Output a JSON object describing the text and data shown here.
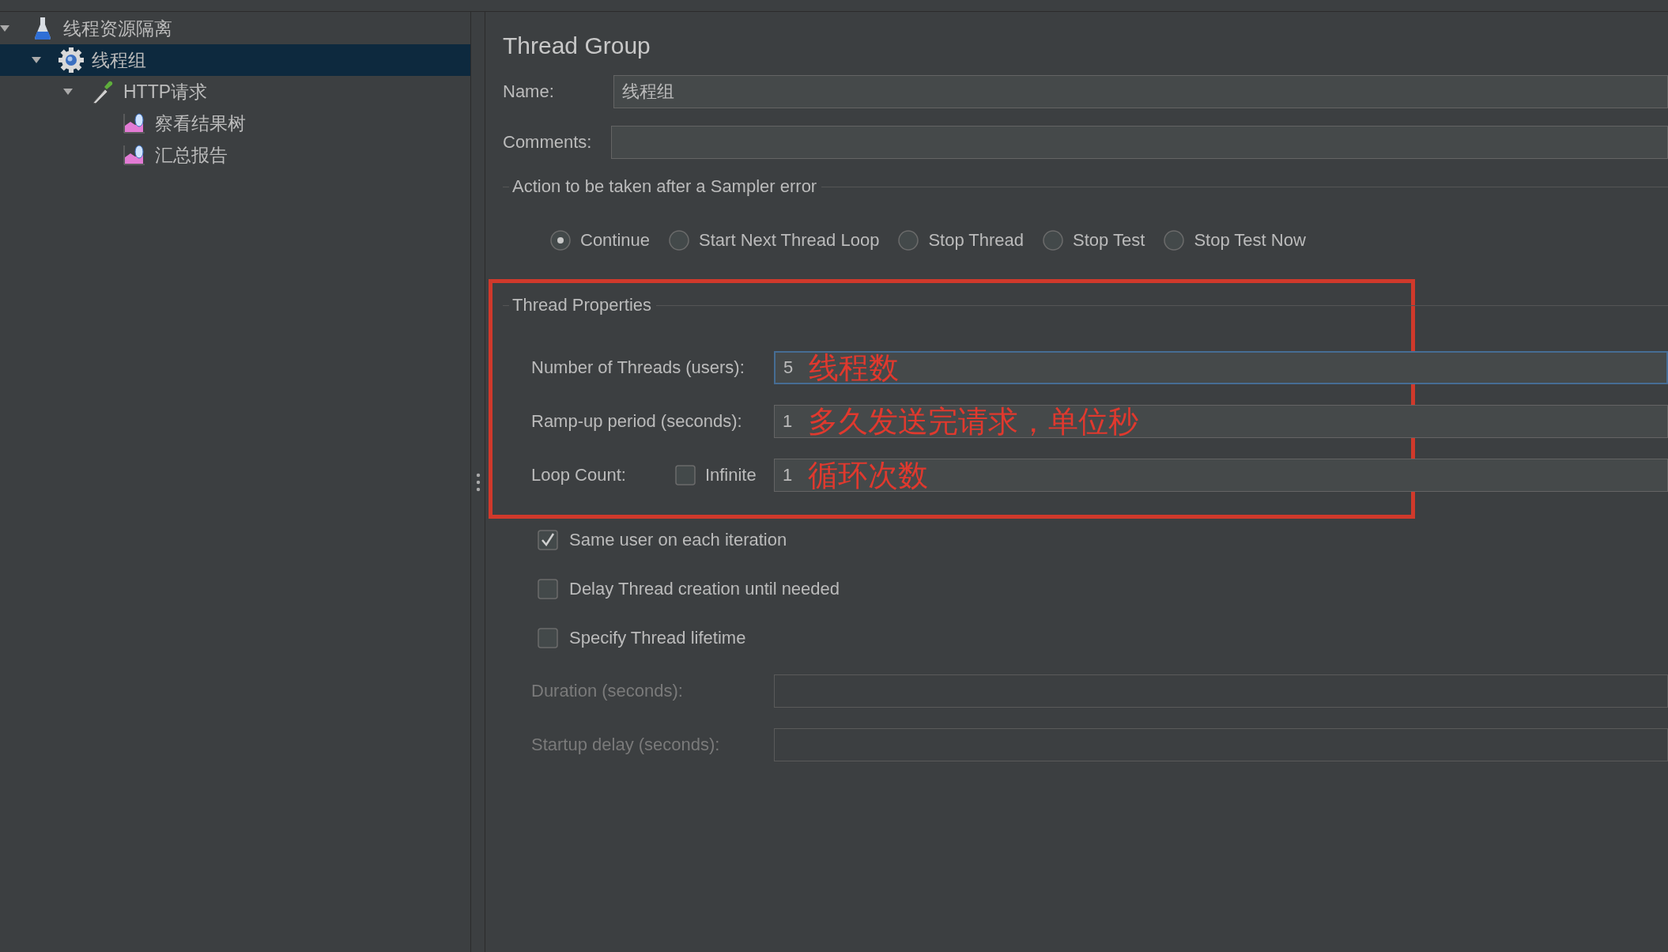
{
  "tree": [
    {
      "label": "线程资源隔离",
      "kind": "plan",
      "expanded": true,
      "selected": false,
      "children": [
        {
          "label": "线程组",
          "kind": "thread-group",
          "expanded": true,
          "selected": true,
          "children": [
            {
              "label": "HTTP请求",
              "kind": "sampler",
              "expanded": true,
              "selected": false,
              "children": [
                {
                  "label": "察看结果树",
                  "kind": "listener",
                  "selected": false
                },
                {
                  "label": "汇总报告",
                  "kind": "listener",
                  "selected": false
                }
              ]
            }
          ]
        }
      ]
    }
  ],
  "editor": {
    "title": "Thread Group",
    "name": {
      "label": "Name:",
      "value": "线程组"
    },
    "comments": {
      "label": "Comments:"
    },
    "sampler_error": {
      "legend": "Action to be taken after a Sampler error",
      "options": [
        {
          "label": "Continue",
          "selected": true
        },
        {
          "label": "Start Next Thread Loop",
          "selected": false
        },
        {
          "label": "Stop Thread",
          "selected": false
        },
        {
          "label": "Stop Test",
          "selected": false
        },
        {
          "label": "Stop Test Now",
          "selected": false
        }
      ]
    },
    "thread_properties": {
      "legend": "Thread Properties",
      "fields": [
        {
          "label": "Number of Threads (users):",
          "value": "5",
          "focused": true,
          "annotation": "线程数"
        },
        {
          "label": "Ramp-up period (seconds):",
          "value": "1",
          "focused": false,
          "annotation": "多久发送完请求，单位秒"
        },
        {
          "label": "Loop Count:",
          "value": "1",
          "focused": false,
          "annotation": "循环次数",
          "infinite": {
            "label": "Infinite",
            "checked": false
          }
        }
      ]
    },
    "options": [
      {
        "label": "Same user on each iteration",
        "checked": true
      },
      {
        "label": "Delay Thread creation until needed",
        "checked": false
      },
      {
        "label": "Specify Thread lifetime",
        "checked": false
      }
    ],
    "lifetime_fields": [
      {
        "label": "Duration (seconds):",
        "disabled": true
      },
      {
        "label": "Startup delay (seconds):",
        "disabled": true
      }
    ]
  }
}
